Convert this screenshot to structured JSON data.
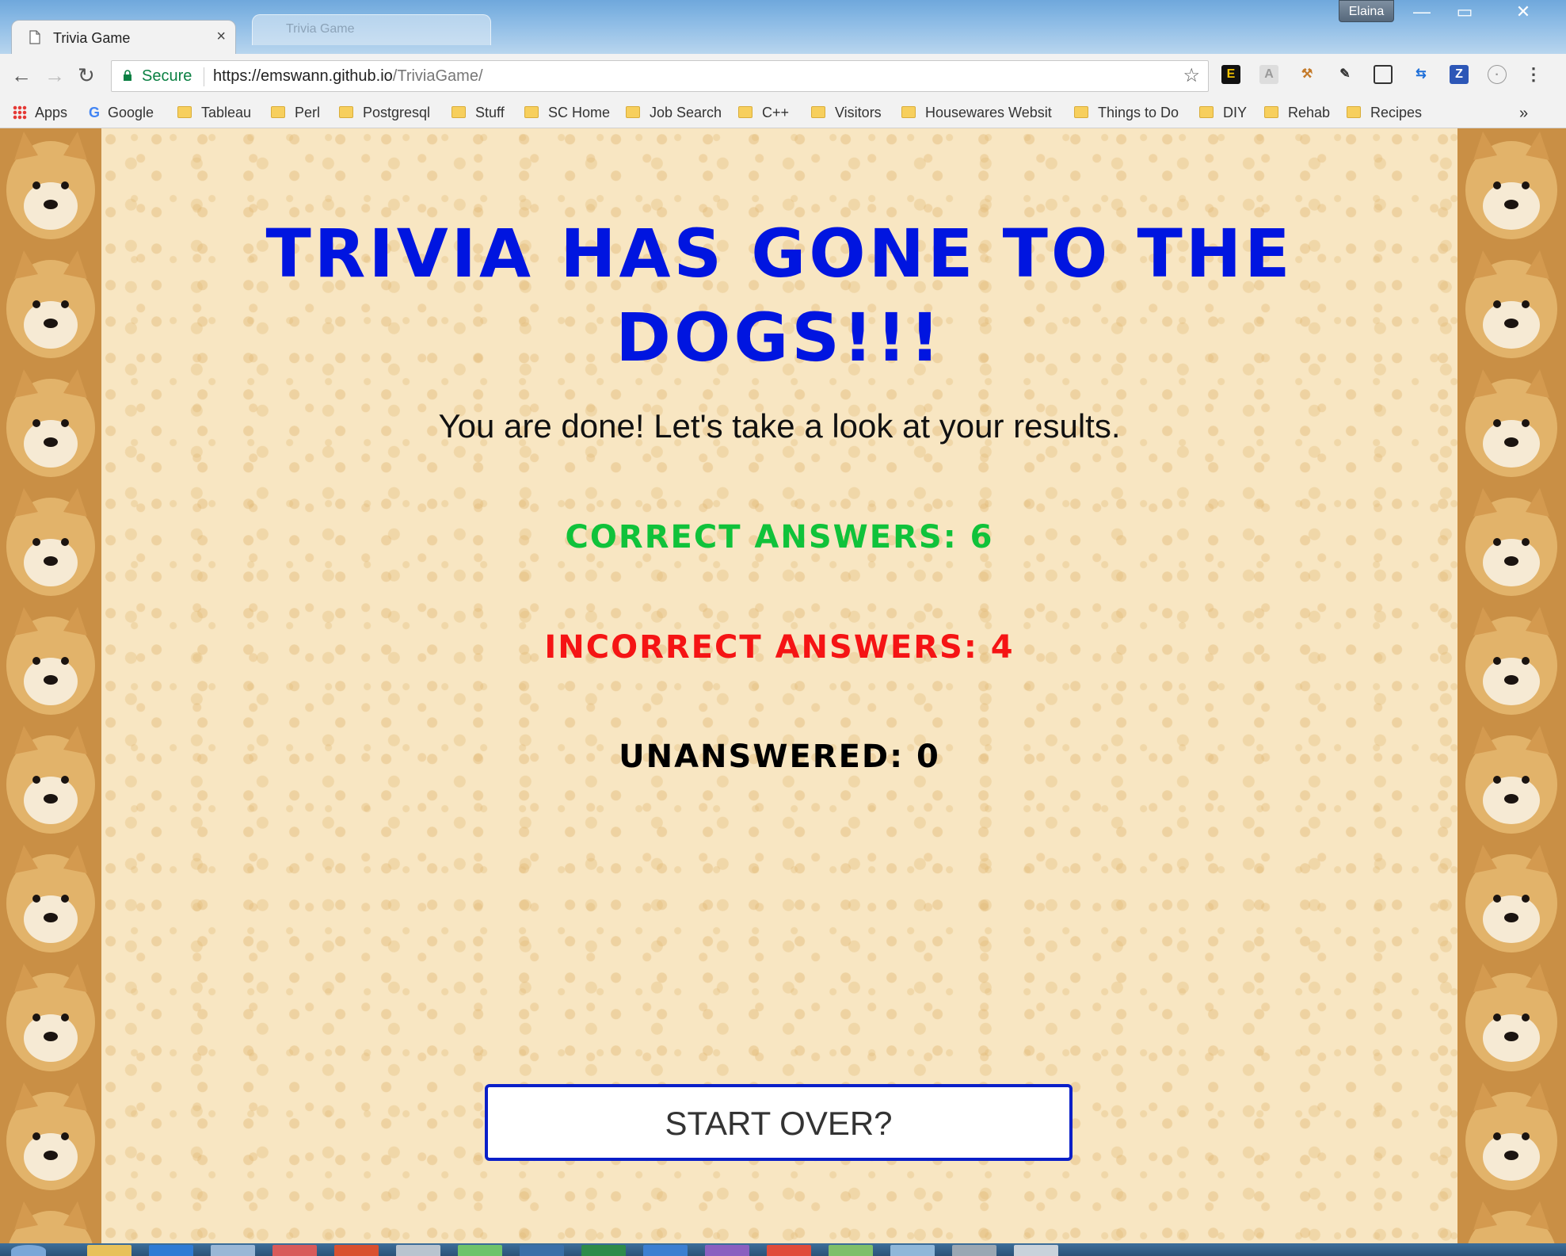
{
  "browser": {
    "tab_title": "Trivia Game",
    "tab_close": "×",
    "ghost_tab_title": "Trivia Game",
    "user_name": "Elaina",
    "window_buttons": {
      "minimize": "—",
      "maximize": "▭",
      "close": "✕"
    },
    "nav": {
      "back": "←",
      "forward": "→",
      "reload": "↻"
    },
    "secure_label": "Secure",
    "url_host": "https://emswann.github.io",
    "url_path": "/TriviaGame/",
    "bookmark_star": "☆",
    "menu": "⋮",
    "bookmarks": [
      "Apps",
      "Google",
      "Tableau",
      "Perl",
      "Postgresql",
      "Stuff",
      "SC Home",
      "Job Search",
      "C++",
      "Visitors",
      "Housewares Website",
      "Things to Do",
      "DIY",
      "Rehab",
      "Recipes"
    ],
    "bookmarks_overflow": "»"
  },
  "page": {
    "title_line1": "Trivia Has Gone To The",
    "title_line2": "Dogs!!!",
    "subtitle": "You are done! Let's take a look at your results.",
    "correct_label": "Correct Answers: 6",
    "incorrect_label": "Incorrect Answers: 4",
    "unanswered_label": "Unanswered: 0",
    "start_over": "START OVER?"
  },
  "colors": {
    "title": "#0015e0",
    "correct": "#10c23a",
    "incorrect": "#f51414",
    "unanswered": "#000000",
    "button_border": "#0a1fc8"
  }
}
